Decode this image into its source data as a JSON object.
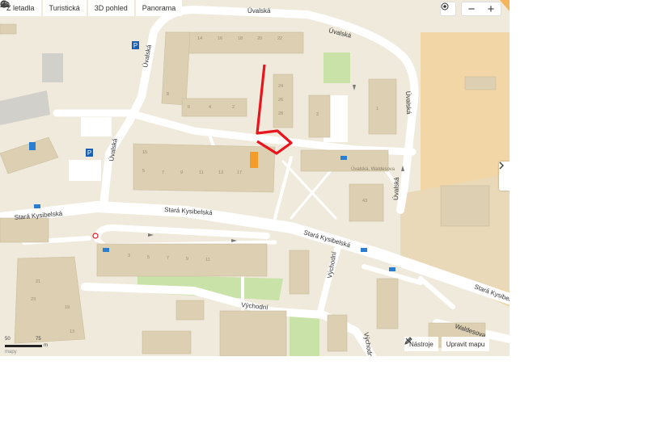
{
  "toolbar": {
    "from_plane_label": "Z letadla",
    "tourist_label": "Turistická",
    "view3d_label": "3D pohled",
    "panorama_label": "Panorama"
  },
  "controls": {
    "zoom_in": "+",
    "zoom_out": "−",
    "expand": "›"
  },
  "bottom_tools": {
    "tools_label": "Nástroje",
    "edit_map_label": "Upravit mapu"
  },
  "scale": {
    "left": "50",
    "right": "75",
    "unit": "m",
    "brand": "mapy"
  },
  "streets": {
    "uvalska_top": "Úvalská",
    "uvalska_left": "Úvalská",
    "uvalska_mid": "Úvalská",
    "uvalska_right": "Úvalská",
    "uvalska_right2": "Úvalská",
    "stara_kysibelska_left": "Stará Kysibelská",
    "stara_kysibelska_mid": "Stará Kysibelská",
    "stara_kysibelska_center": "Stará Kysibelská",
    "stara_kysibelska_right": "Stará Kysibelská",
    "vychodni_mid": "Východní",
    "vychodni_vertical": "Východní",
    "vychodni_bottom": "Východní",
    "waldesova": "Waldesova"
  },
  "poi": {
    "school_label": "Úvalská, Waldesova"
  },
  "house_numbers": {
    "n1": "14",
    "n2": "16",
    "n3": "18",
    "n4": "20",
    "n5": "22",
    "n6": "8",
    "n7": "6",
    "n8": "4",
    "n9": "2",
    "n10": "24",
    "n11": "26",
    "n12": "28",
    "n13": "5",
    "n14": "7",
    "n15": "9",
    "n16": "11",
    "n17": "13",
    "n18": "15",
    "n19": "17",
    "n20": "3",
    "n21": "1",
    "n22": "43",
    "n23": "21",
    "n24": "23",
    "n25": "19",
    "n26": "13",
    "n27": "3",
    "n28": "5",
    "n29": "7",
    "n30": "9",
    "n31": "11"
  },
  "colors": {
    "background": "#efeadb",
    "road": "#ffffff",
    "building": "#dccfb2",
    "grass": "#c9e2a8",
    "route": "#e8141e",
    "orange": "#f5b55a"
  }
}
